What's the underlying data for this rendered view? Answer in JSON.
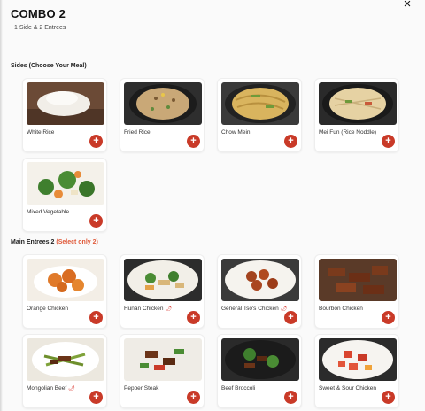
{
  "header": {
    "title": "COMBO 2",
    "subtitle": "1 Side & 2 Entrees",
    "close_icon": "×"
  },
  "sides": {
    "title": "Sides (Choose Your Meal)",
    "items": [
      {
        "name": "White Rice"
      },
      {
        "name": "Fried Rice"
      },
      {
        "name": "Chow Mein"
      },
      {
        "name": "Mei Fun (Rice Noddle)"
      },
      {
        "name": "Mixed Vegetable"
      }
    ]
  },
  "entrees": {
    "title": "Main Entrees 2",
    "requirement": "(Select only 2)",
    "items": [
      {
        "name": "Orange Chicken",
        "spicy": false
      },
      {
        "name": "Hunan Chicken",
        "spicy": true
      },
      {
        "name": "General Tso's Chicken",
        "spicy": true
      },
      {
        "name": "Bourbon Chicken",
        "spicy": false
      },
      {
        "name": "Mongolian Beef",
        "spicy": true
      },
      {
        "name": "Pepper Steak",
        "spicy": false
      },
      {
        "name": "Beef Broccoli",
        "spicy": false
      },
      {
        "name": "Sweet & Sour Chicken",
        "spicy": false
      }
    ]
  },
  "add_button_label": "+",
  "spicy_icon": "chili-pepper-icon",
  "colors": {
    "accent": "#c93a28",
    "requirement": "#e05a3a"
  }
}
